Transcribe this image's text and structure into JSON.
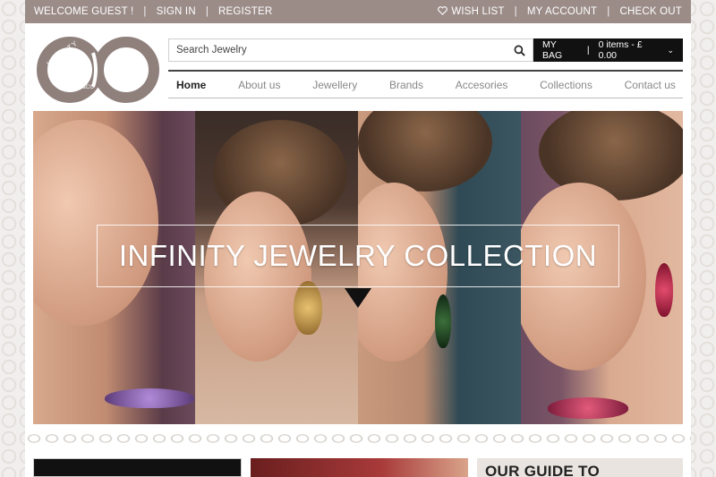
{
  "topbar": {
    "welcome": "WELCOME GUEST !",
    "sign_in": "SIGN IN",
    "register": "REGISTER",
    "wishlist": "WISH LIST",
    "my_account": "MY ACCOUNT",
    "checkout": "CHECK OUT",
    "separator": "|"
  },
  "logo": {
    "text_top": "INFINITY",
    "text_co": "&CO"
  },
  "search": {
    "placeholder": "Search Jewelry",
    "icon": "search-icon"
  },
  "bag": {
    "label": "MY BAG",
    "separator": "|",
    "summary": "0 items  - £ 0.00",
    "chevron": "⌄"
  },
  "nav": {
    "items": [
      {
        "label": "Home",
        "active": true
      },
      {
        "label": "About us"
      },
      {
        "label": "Jewellery"
      },
      {
        "label": "Brands"
      },
      {
        "label": "Accesories"
      },
      {
        "label": "Collections"
      },
      {
        "label": "Contact us"
      }
    ]
  },
  "hero": {
    "title": "INFINITY JEWELRY COLLECTION"
  },
  "teasers": {
    "third_text": "OUR GUIDE TO"
  },
  "colors": {
    "topbar_bg": "#9b8c88",
    "bag_bg": "#111111",
    "brand_taupe": "#8f807c"
  }
}
